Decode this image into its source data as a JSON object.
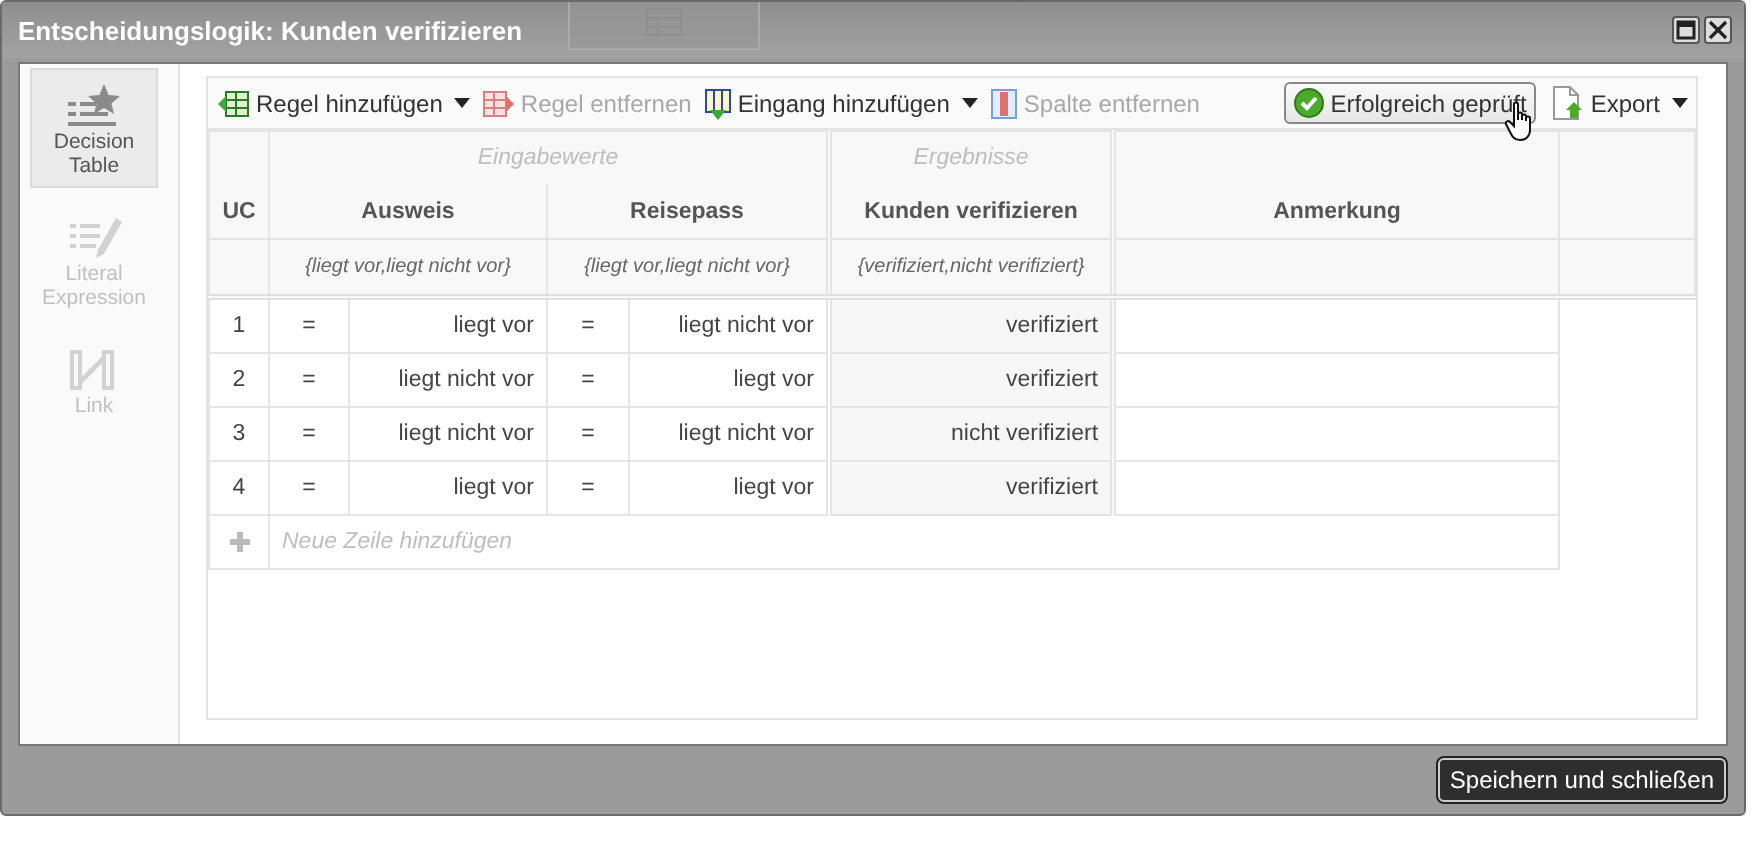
{
  "window": {
    "title": "Entscheidungslogik: Kunden verifizieren"
  },
  "sidebar": {
    "items": [
      {
        "label": "Decision Table",
        "selected": true
      },
      {
        "label": "Literal Expression",
        "selected": false
      },
      {
        "label": "Link",
        "selected": false
      }
    ]
  },
  "toolbar": {
    "actions": [
      {
        "label": "Regel hinzufügen",
        "disabled": false,
        "dropdown": true
      },
      {
        "label": "Regel entfernen",
        "disabled": true,
        "dropdown": false
      },
      {
        "label": "Eingang hinzufügen",
        "disabled": false,
        "dropdown": true
      },
      {
        "label": "Spalte entfernen",
        "disabled": true,
        "dropdown": false
      }
    ],
    "validation": {
      "label": "Erfolgreich geprüft"
    },
    "export": {
      "label": "Export",
      "dropdown": true
    }
  },
  "table": {
    "group_headers": [
      {
        "label": "Eingabewerte"
      },
      {
        "label": "Ergebnisse"
      }
    ],
    "columns": [
      "UC",
      "Ausweis",
      "Reisepass",
      "Kunden verifizieren",
      "Anmerkung"
    ],
    "value_lists": [
      "{liegt vor,liegt nicht vor}",
      "{liegt vor,liegt nicht vor}",
      "{verifiziert,nicht verifiziert}"
    ],
    "rows": [
      {
        "uc": "1",
        "ausweis_op": "=",
        "ausweis": "liegt vor",
        "reisepass_op": "=",
        "reisepass": "liegt nicht vor",
        "result": "verifiziert"
      },
      {
        "uc": "2",
        "ausweis_op": "=",
        "ausweis": "liegt nicht vor",
        "reisepass_op": "=",
        "reisepass": "liegt vor",
        "result": "verifiziert"
      },
      {
        "uc": "3",
        "ausweis_op": "=",
        "ausweis": "liegt nicht vor",
        "reisepass_op": "=",
        "reisepass": "liegt nicht vor",
        "result": "nicht verifiziert"
      },
      {
        "uc": "4",
        "ausweis_op": "=",
        "ausweis": "liegt vor",
        "reisepass_op": "=",
        "reisepass": "liegt vor",
        "result": "verifiziert"
      }
    ],
    "add_row": {
      "label": "Neue Zeile hinzufügen"
    }
  },
  "footer": {
    "save_button": "Speichern und schließen"
  }
}
